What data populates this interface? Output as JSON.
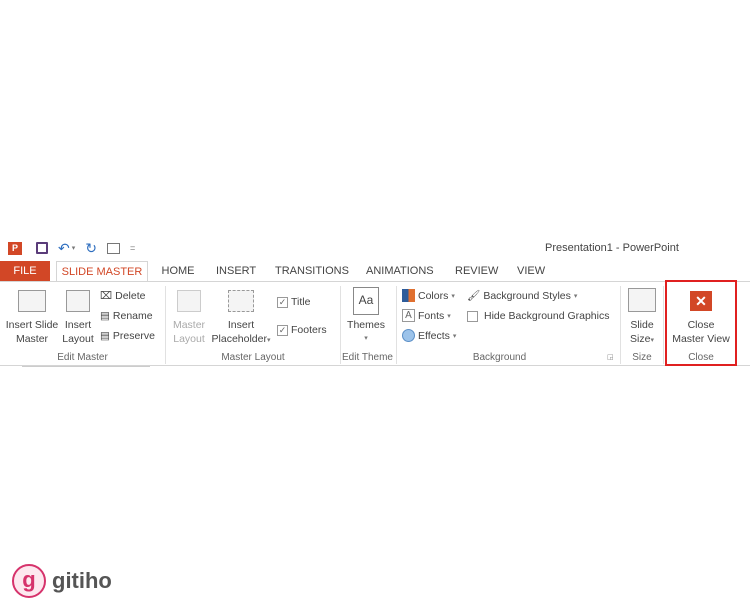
{
  "window_title": "Presentation1 - PowerPoint",
  "quick_access": {
    "app_icon": "powerpoint-icon",
    "save": "save-icon",
    "undo": "undo-icon",
    "redo": "redo-icon",
    "presenter": "start-slideshow-icon",
    "customize": "="
  },
  "tabs": [
    "FILE",
    "SLIDE MASTER",
    "HOME",
    "INSERT",
    "TRANSITIONS",
    "ANIMATIONS",
    "REVIEW",
    "VIEW"
  ],
  "active_tab": "SLIDE MASTER",
  "groups": {
    "edit_master": {
      "label": "Edit Master",
      "insert_slide_master": [
        "Insert Slide",
        "Master"
      ],
      "insert_layout": [
        "Insert",
        "Layout"
      ],
      "delete": "Delete",
      "rename": "Rename",
      "preserve": "Preserve"
    },
    "master_layout": {
      "label": "Master Layout",
      "master_layout": [
        "Master",
        "Layout"
      ],
      "insert_placeholder": [
        "Insert",
        "Placeholder"
      ],
      "title": "Title",
      "footers": "Footers",
      "title_checked": true,
      "footers_checked": true
    },
    "edit_theme": {
      "label": "Edit Theme",
      "themes": "Themes",
      "themes_icon": "Aa"
    },
    "background": {
      "label": "Background",
      "colors": "Colors",
      "fonts": "Fonts",
      "effects": "Effects",
      "background_styles": "Background Styles",
      "hide_bg": "Hide Background Graphics",
      "fonts_icon": "A"
    },
    "size": {
      "label": "Size",
      "slide_size": [
        "Slide",
        "Size"
      ]
    },
    "close": {
      "label": "Close",
      "close_master_view": [
        "Close",
        "Master View"
      ]
    }
  },
  "colors": {
    "accent": "#d24726",
    "highlight": "#e02020"
  },
  "watermark": {
    "brand": "gitiho"
  }
}
